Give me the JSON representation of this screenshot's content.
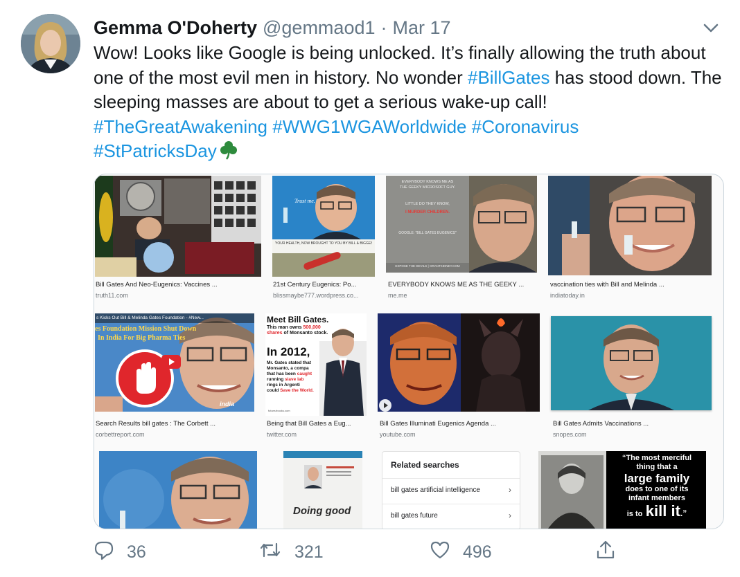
{
  "tweet": {
    "author_name": "Gemma O'Doherty",
    "handle": "@gemmaod1",
    "separator": "·",
    "date": "Mar 17",
    "text_part1": "Wow! Looks like Google is being unlocked. It’s finally allowing the truth about one of the most evil men in history. No wonder ",
    "hashtag_billgates": "#BillGates",
    "text_part2": " has stood down. The sleeping masses are about to get a serious wake-up call!",
    "hashtag_1": "#TheGreatAwakening",
    "hashtag_2": "#WWG1WGAWorldwide",
    "hashtag_3": "#Coronavirus",
    "hashtag_4": "#StPatricksDay"
  },
  "results": [
    {
      "caption": "Bill Gates And Neo-Eugenics: Vaccines ...",
      "source": "truth11.com"
    },
    {
      "caption": "21st Century Eugenics: Po...",
      "source": "blissmaybe777.wordpress.co..."
    },
    {
      "caption": "EVERYBODY KNOWS ME AS THE GEEKY ...",
      "source": "me.me"
    },
    {
      "caption": "vaccination ties with Bill and Melinda ...",
      "source": "indiatoday.in"
    },
    {
      "caption": "Search Results bill gates : The Corbett ...",
      "source": "corbettreport.com"
    },
    {
      "caption": "Being that Bill Gates a Eug...",
      "source": "twitter.com"
    },
    {
      "caption": "Bill Gates Illuminati Eugenics Agenda ...",
      "source": "youtube.com"
    },
    {
      "caption": "Bill Gates Admits Vaccinations ...",
      "source": "snopes.com"
    }
  ],
  "image_text": {
    "trust_me": "Trust me.",
    "your_health": "YOUR HEALTH, NOW BROUGHT TO YOU BY BILL & BIGGEST",
    "meme_line1": "EVERYBODY KNOWS ME AS",
    "meme_line2": "THE GEEKY MICROSOFT GUY.",
    "meme_line3": "LITTLE DO THEY KNOW,",
    "meme_line4": "I MURDER CHILDREN.",
    "meme_line5": "GOOGLE: \"BILL GATES EUGENICS\"",
    "meme_footer": "EXPOSE THE DEVILS | GRANTKIDNEY.COM",
    "corbett_top": "s Kicks Out Bill & Melinda Gates Foundation - #New...",
    "corbett_title1": "es Foundation Mission Shut Down",
    "corbett_title2": "In India For Big Pharma Ties",
    "corbett_logo": "india",
    "meet_title": "Meet Bill Gates.",
    "meet_sub1": "This man owns",
    "meet_highlight1": "500,000",
    "meet_sub2": "shares",
    "meet_sub3": "of Monsanto stock.",
    "meet_year": "In 2012,",
    "meet_body1": "Mr. Gates stated that",
    "meet_body2": "Monsanto, a compa",
    "meet_body3": "that has been",
    "meet_highlight2": "caught",
    "meet_body4": "running",
    "meet_highlight3": "slave lab",
    "meet_body5": "rings in Argenti",
    "meet_body6": "could",
    "meet_highlight4": "Save the World.",
    "meet_footer": "futurezbooks.com",
    "doing_good": "Doing good",
    "quote_line1": "“The most merciful",
    "quote_line2": "thing that a",
    "quote_line3": "large family",
    "quote_line4": "does to one of its",
    "quote_line5": "infant members",
    "quote_line6": "is to",
    "quote_line7": "kill it",
    "quote_end": ".”"
  },
  "related": {
    "title": "Related searches",
    "items": [
      "bill gates artificial intelligence",
      "bill gates future"
    ],
    "chevron": "›"
  },
  "actions": {
    "replies": "36",
    "retweets": "321",
    "likes": "496"
  },
  "icons": [
    "caret-down-icon",
    "reply-icon",
    "retweet-icon",
    "like-icon",
    "share-icon",
    "shamrock-icon",
    "play-icon",
    "stop-hand-icon"
  ],
  "colors": {
    "hashtag": "#1b95e0",
    "secondary": "#657786",
    "shamrock": "#2e8b3d",
    "danger": "#e0262c"
  }
}
